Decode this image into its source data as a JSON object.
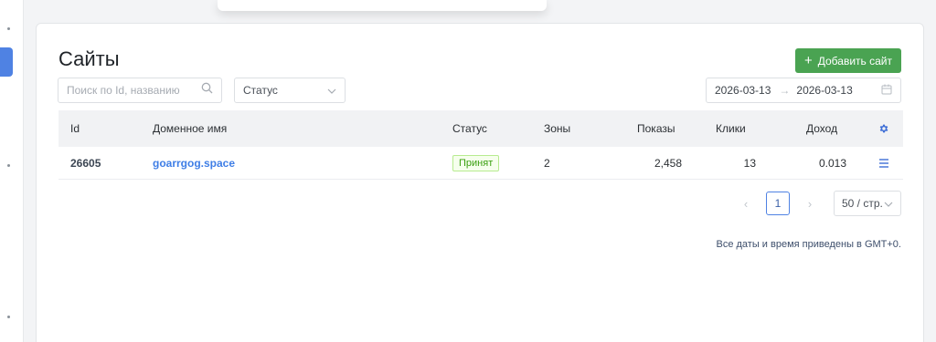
{
  "page": {
    "title": "Сайты",
    "add_button_label": "Добавить сайт"
  },
  "filters": {
    "search_placeholder": "Поиск по Id, названию",
    "status_placeholder": "Статус",
    "date_from": "2026-03-13",
    "date_to": "2026-03-13"
  },
  "table": {
    "headers": {
      "id": "Id",
      "domain": "Доменное имя",
      "status": "Статус",
      "zones": "Зоны",
      "shows": "Показы",
      "clicks": "Клики",
      "income": "Доход"
    },
    "rows": [
      {
        "id": "26605",
        "domain": "goarrgog.space",
        "status": "Принят",
        "zones": "2",
        "shows": "2,458",
        "clicks": "13",
        "income": "0.013"
      }
    ]
  },
  "pagination": {
    "current_page": "1",
    "page_size": "50 / стр."
  },
  "footer_note": "Все даты и время приведены в GMT+0.",
  "colors": {
    "accent": "#4f82e3",
    "add_button": "#4aa352",
    "status_accepted": "#389e0d"
  },
  "icons": {
    "search": "search-icon",
    "calendar": "calendar-icon",
    "settings": "gear-icon",
    "row_menu": "menu-icon"
  }
}
